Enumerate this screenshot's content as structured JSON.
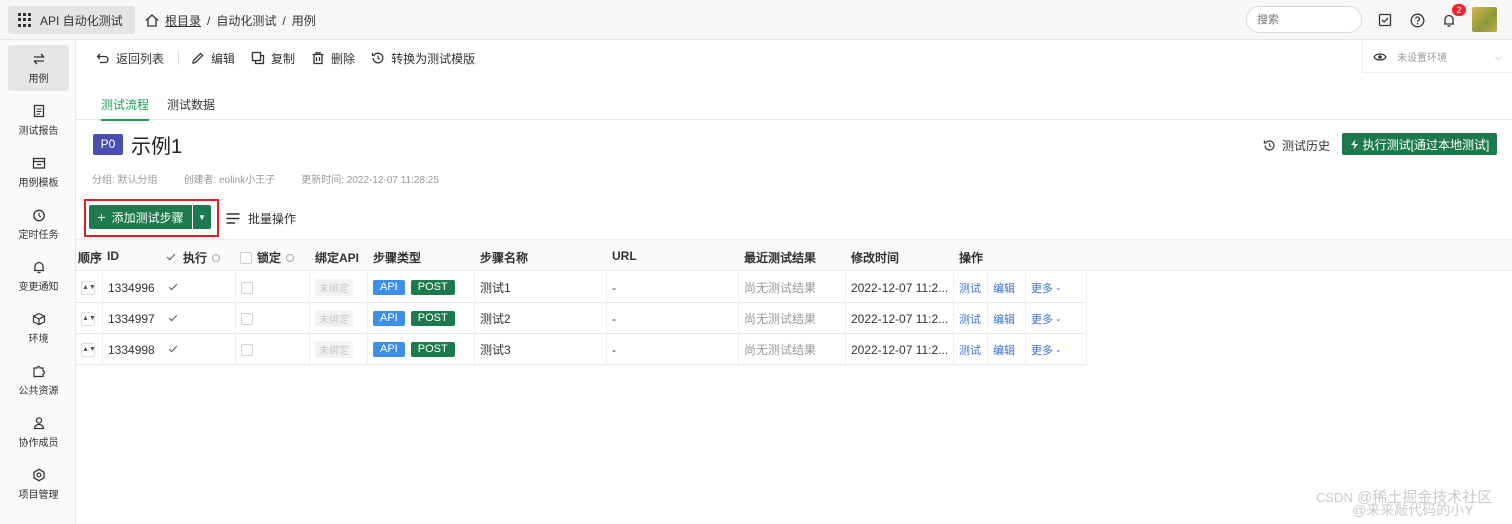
{
  "topbar": {
    "app_name": "API 自动化测试",
    "breadcrumb": {
      "home": "根目录",
      "sep1": "/",
      "section": "自动化测试",
      "sep2": "/",
      "page": "用例"
    },
    "search_placeholder": "搜索",
    "notification_count": "2"
  },
  "sidebar": {
    "items": [
      {
        "label": "用例",
        "icon": "swap-arrows-icon"
      },
      {
        "label": "测试报告",
        "icon": "report-icon"
      },
      {
        "label": "用例模板",
        "icon": "template-icon"
      },
      {
        "label": "定时任务",
        "icon": "timer-icon"
      },
      {
        "label": "变更通知",
        "icon": "bell-icon"
      },
      {
        "label": "环境",
        "icon": "cube-icon"
      },
      {
        "label": "公共资源",
        "icon": "puzzle-icon"
      },
      {
        "label": "协作成员",
        "icon": "people-icon"
      },
      {
        "label": "项目管理",
        "icon": "settings-icon"
      }
    ]
  },
  "toolbar": {
    "back": "返回列表",
    "edit": "编辑",
    "copy": "复制",
    "delete": "删除",
    "convert": "转换为测试模版"
  },
  "env": {
    "label": "未设置环境"
  },
  "tabs": [
    {
      "label": "测试流程"
    },
    {
      "label": "测试数据"
    }
  ],
  "case": {
    "priority": "P0",
    "title": "示例1",
    "group": "分组: 默认分组",
    "creator": "创建者: eolink小王子",
    "updated": "更新时间: 2022-12-07 11:28:25",
    "history": "测试历史",
    "run": "执行测试[通过本地测试]"
  },
  "actions": {
    "add_step": "添加测试步骤",
    "batch": "批量操作"
  },
  "table": {
    "headers": {
      "order": "顺序",
      "id": "ID",
      "exec": "执行",
      "lock": "锁定",
      "bind_api": "绑定API",
      "step_type": "步骤类型",
      "step_name": "步骤名称",
      "url": "URL",
      "last_result": "最近测试结果",
      "modified": "修改时间",
      "ops": "操作"
    },
    "rows": [
      {
        "id": "1334996",
        "bind": "未绑定",
        "type": "API",
        "method": "POST",
        "name": "测试1",
        "url": "-",
        "result": "尚无测试结果",
        "modified": "2022-12-07 11:2...",
        "op_test": "测试",
        "op_edit": "编辑",
        "op_more": "更多"
      },
      {
        "id": "1334997",
        "bind": "未绑定",
        "type": "API",
        "method": "POST",
        "name": "测试2",
        "url": "-",
        "result": "尚无测试结果",
        "modified": "2022-12-07 11:2...",
        "op_test": "测试",
        "op_edit": "编辑",
        "op_more": "更多"
      },
      {
        "id": "1334998",
        "bind": "未绑定",
        "type": "API",
        "method": "POST",
        "name": "测试3",
        "url": "-",
        "result": "尚无测试结果",
        "modified": "2022-12-07 11:2...",
        "op_test": "测试",
        "op_edit": "编辑",
        "op_more": "更多"
      }
    ]
  },
  "watermark": {
    "csdn": "CSDN",
    "text": "@稀土掘金技术社区",
    "text2": "@来来敲代码的小Y"
  },
  "colors": {
    "primary_green": "#1d7a4f",
    "tab_green": "#1f9d55",
    "api_blue": "#3d8fe8",
    "priority_purple": "#4a4fb1",
    "highlight_red": "#e02020"
  }
}
